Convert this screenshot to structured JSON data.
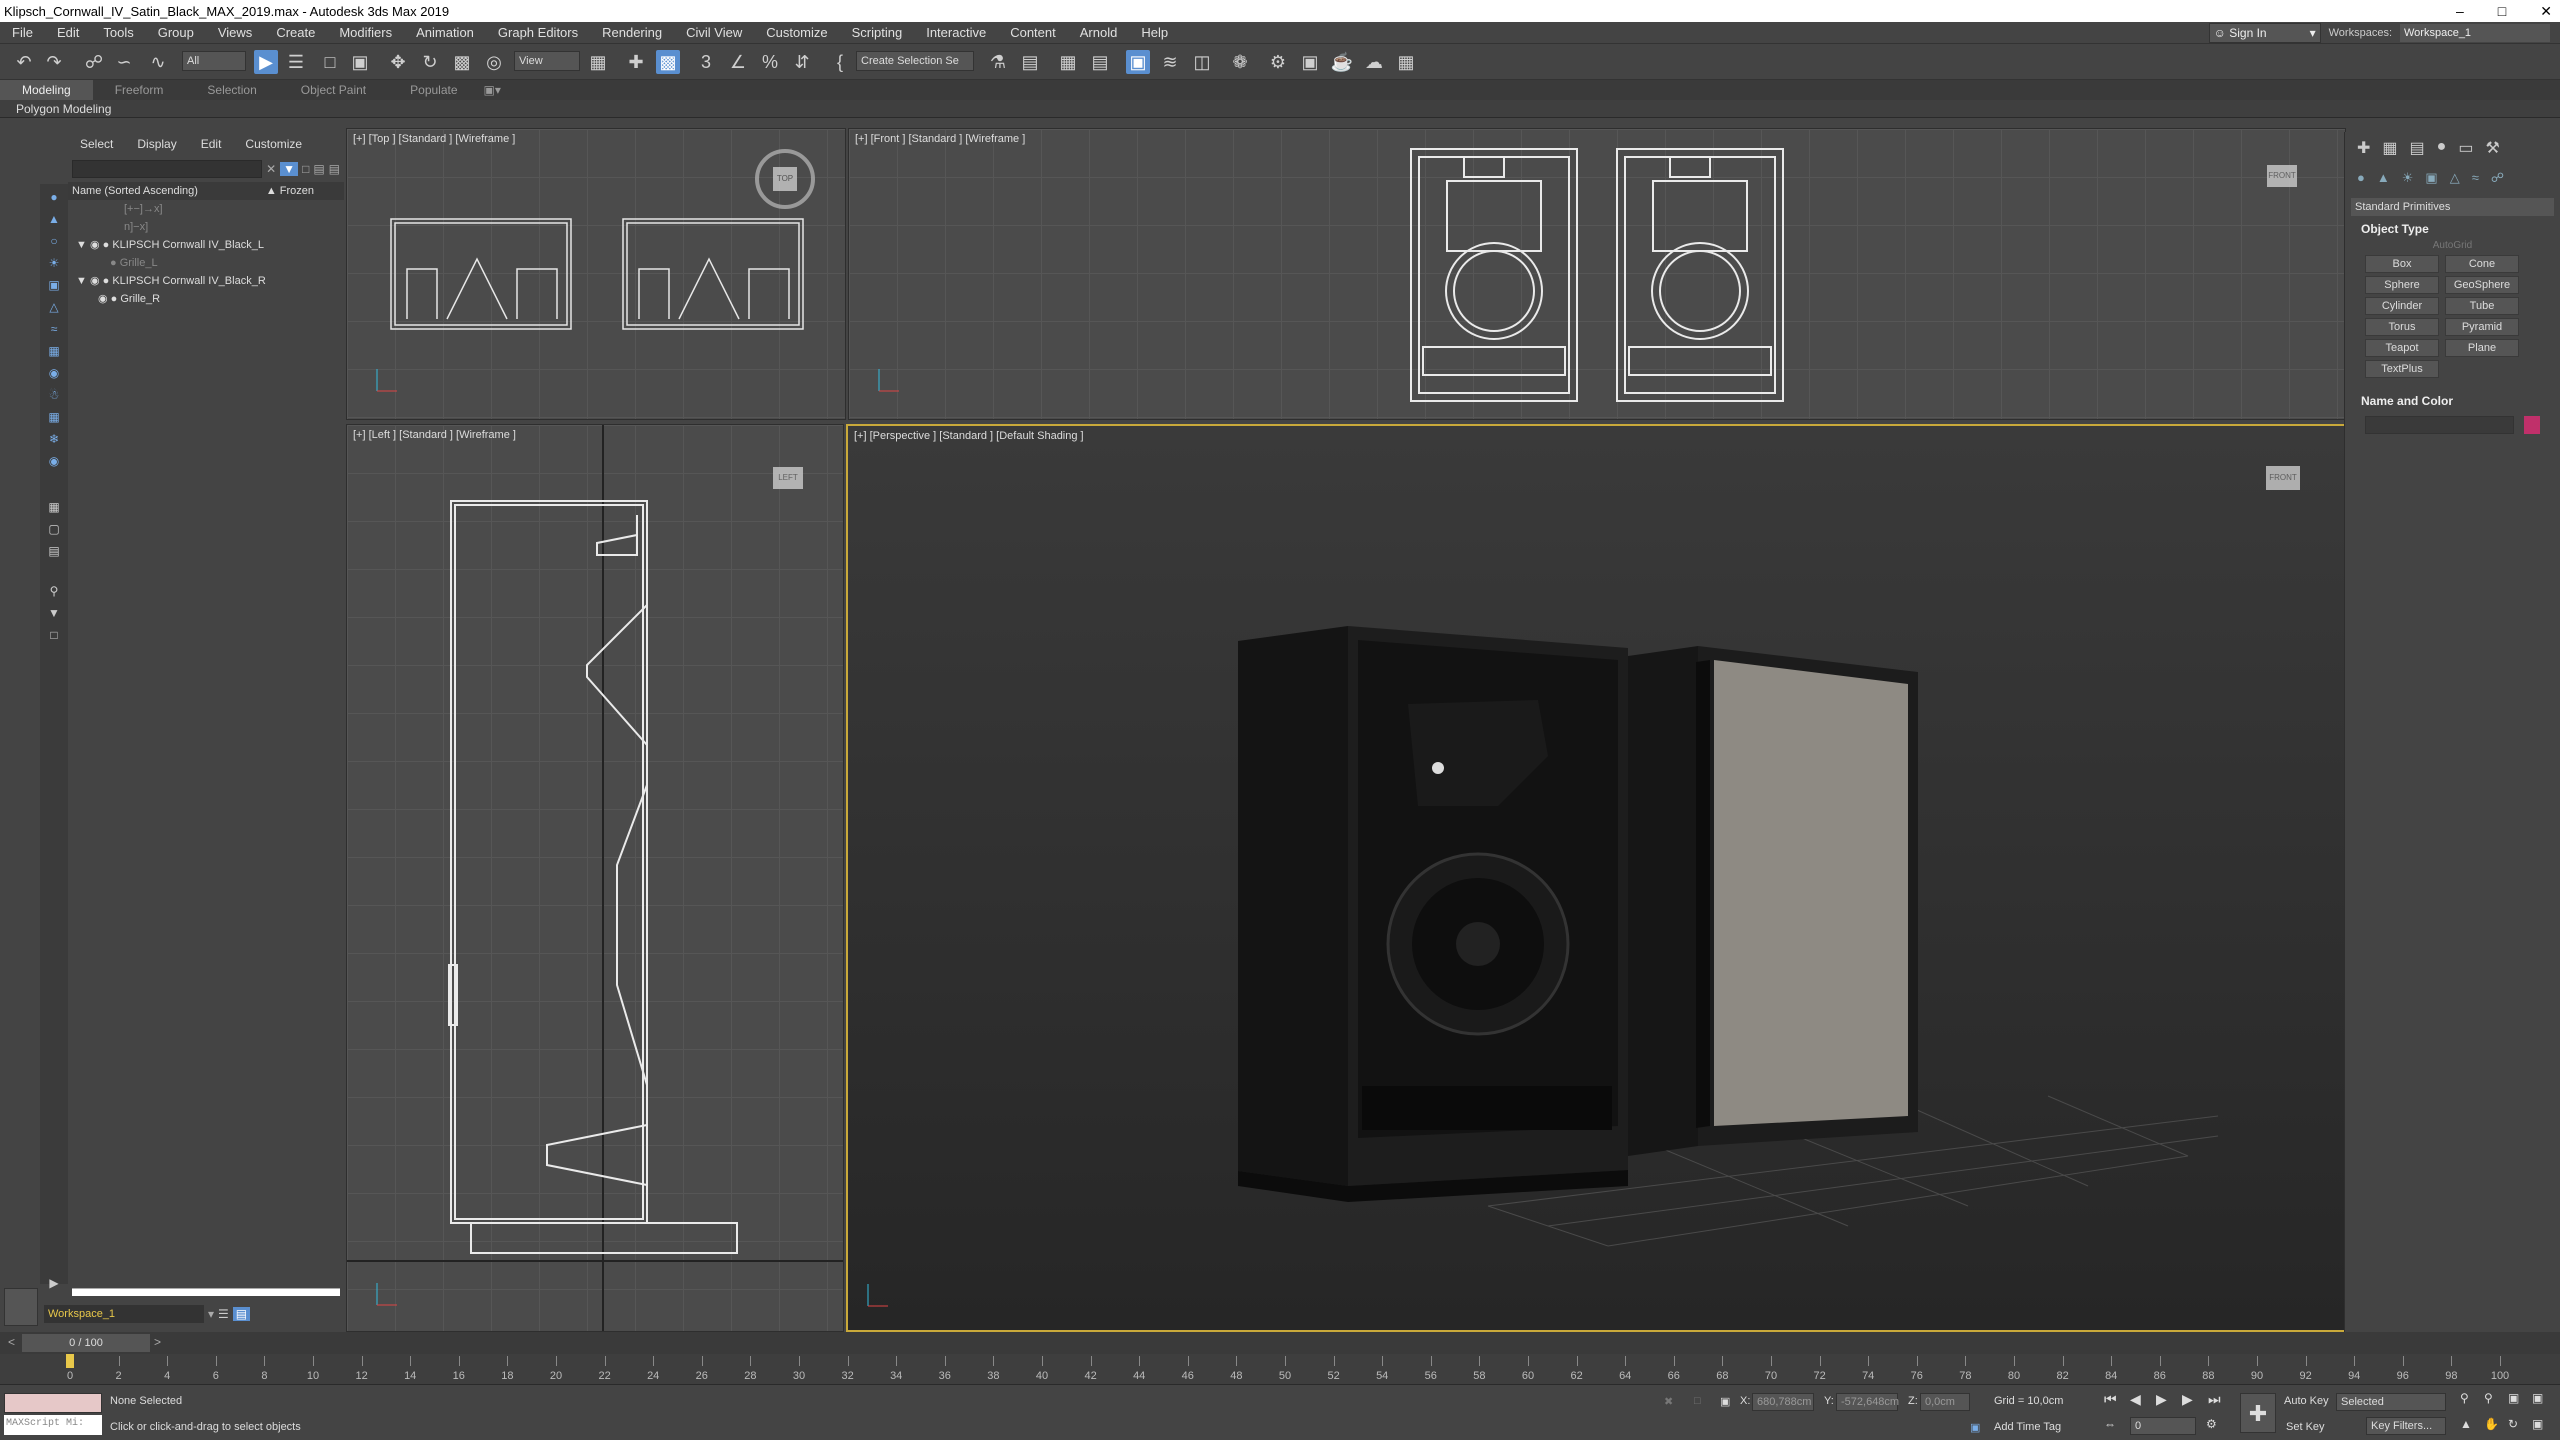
{
  "app": {
    "title": "Klipsch_Cornwall_IV_Satin_Black_MAX_2019.max - Autodesk 3ds Max 2019",
    "window_buttons": [
      "–",
      "□",
      "✕"
    ]
  },
  "menu": {
    "items": [
      "File",
      "Edit",
      "Tools",
      "Group",
      "Views",
      "Create",
      "Modifiers",
      "Animation",
      "Graph Editors",
      "Rendering",
      "Civil View",
      "Customize",
      "Scripting",
      "Interactive",
      "Content",
      "Arnold",
      "Help"
    ],
    "sign_in": "Sign In",
    "workspaces_label": "Workspaces:",
    "workspace_value": "Workspace_1"
  },
  "toolbar": {
    "filter_value": "All",
    "coord_value": "View",
    "selection_set_placeholder": "Create Selection Se"
  },
  "ribbon": {
    "tabs": [
      "Modeling",
      "Freeform",
      "Selection",
      "Object Paint",
      "Populate"
    ],
    "active_tab": "Modeling",
    "sub_label": "Polygon Modeling"
  },
  "scene_explorer": {
    "tabs": [
      "Select",
      "Display",
      "Edit",
      "Customize"
    ],
    "col_name": "Name (Sorted Ascending)",
    "col_frozen": "▲ Frozen",
    "rows": [
      {
        "label": "[+−]→x]",
        "dim": true
      },
      {
        "label": "n]−x]",
        "dim": true
      },
      {
        "label": "KLIPSCH Cornwall IV_Black_L",
        "dim": false
      },
      {
        "label": "Grille_L",
        "dim": true
      },
      {
        "label": "KLIPSCH Cornwall IV_Black_R",
        "dim": false
      },
      {
        "label": "Grille_R",
        "dim": false
      }
    ],
    "workspace_field": "Workspace_1"
  },
  "viewports": {
    "top": "[+] [Top ] [Standard ] [Wireframe ]",
    "front": "[+] [Front ] [Standard ] [Wireframe ]",
    "left": "[+] [Left ] [Standard ] [Wireframe ]",
    "perspective": "[+] [Perspective ] [Standard ] [Default Shading ]",
    "viewcube_top": "TOP",
    "viewcube_left": "LEFT",
    "viewcube_front": "FRONT"
  },
  "command_panel": {
    "category": "Standard Primitives",
    "object_type_title": "Object Type",
    "autogrid": "AutoGrid",
    "primitives": [
      "Box",
      "Cone",
      "Sphere",
      "GeoSphere",
      "Cylinder",
      "Tube",
      "Torus",
      "Pyramid",
      "Teapot",
      "Plane",
      "TextPlus"
    ],
    "name_color_title": "Name and Color",
    "swatch_color": "#c0306a"
  },
  "timeline": {
    "frame_display": "0 / 100",
    "ticks": [
      "0",
      "2",
      "4",
      "6",
      "8",
      "10",
      "12",
      "14",
      "16",
      "18",
      "20",
      "22",
      "24",
      "26",
      "28",
      "30",
      "32",
      "34",
      "36",
      "38",
      "40",
      "42",
      "44",
      "46",
      "48",
      "50",
      "52",
      "54",
      "56",
      "58",
      "60",
      "62",
      "64",
      "66",
      "68",
      "70",
      "72",
      "74",
      "76",
      "78",
      "80",
      "82",
      "84",
      "86",
      "88",
      "90",
      "92",
      "94",
      "96",
      "98",
      "100"
    ]
  },
  "status": {
    "maxscript": "MAXScript Mi:",
    "selection": "None Selected",
    "prompt": "Click or click-and-drag to select objects",
    "x_label": "X:",
    "x_value": "680,788cm",
    "y_label": "Y:",
    "y_value": "-572,648cm",
    "z_label": "Z:",
    "z_value": "0,0cm",
    "grid": "Grid = 10,0cm",
    "add_time_tag": "Add Time Tag",
    "auto_key": "Auto Key",
    "set_key": "Set Key",
    "selected": "Selected",
    "key_filters": "Key Filters...",
    "frame_field": "0"
  }
}
